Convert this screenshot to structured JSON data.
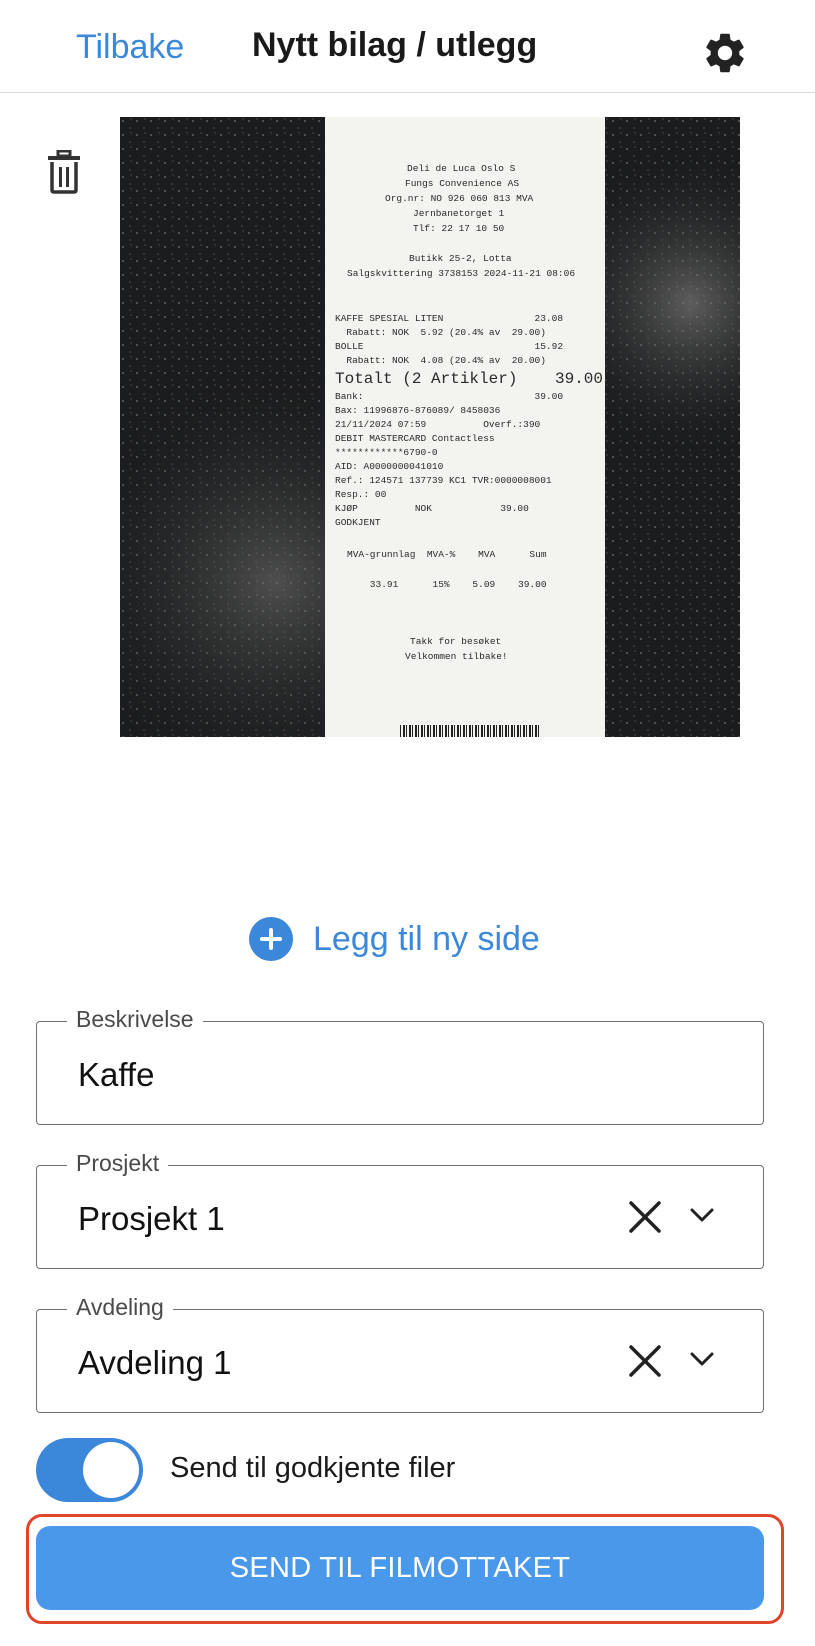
{
  "header": {
    "back_label": "Tilbake",
    "title": "Nytt bilag / utlegg",
    "settings_icon": "gear-icon"
  },
  "attachment": {
    "delete_icon": "trash-icon",
    "receipt_lines": {
      "l1": "Deli de Luca Oslo S",
      "l2": "Fungs Convenience AS",
      "l3": "Org.nr: NO 926 060 813 MVA",
      "l4": "Jernbanetorget 1",
      "l5": "Tlf: 22 17 10 50",
      "l6": "Butikk 25-2, Lotta",
      "l7": "Salgskvittering 3738153 2024-11-21 08:06",
      "l8": "KAFFE SPESIAL LITEN                23.08",
      "l9": "  Rabatt: NOK  5.92 (20.4% av  29.00)",
      "l10": "BOLLE                              15.92",
      "l11": "  Rabatt: NOK  4.08 (20.4% av  20.00)",
      "l12": "Totalt (2 Artikler)",
      "l12v": "39.00",
      "l13": "Bank:                              39.00",
      "l14": "Bax: 11996876-876089/ 8458036",
      "l15": "21/11/2024 07:59          Overf.:390",
      "l16": "DEBIT MASTERCARD Contactless",
      "l17": "************6790-0",
      "l18": "AID: A0000000041010",
      "l19": "Ref.: 124571 137739 KC1 TVR:0000008001",
      "l20": "Resp.: 00",
      "l21": "KJØP          NOK            39.00",
      "l22": "GODKJENT",
      "l23": "MVA-grunnlag  MVA-%    MVA      Sum",
      "l24": "    33.91      15%    5.09    39.00",
      "l25": "Takk for besøket",
      "l26": "Velkommen tilbake!"
    }
  },
  "add_page": {
    "label": "Legg til ny side",
    "icon": "plus-circle-icon"
  },
  "form": {
    "description": {
      "label": "Beskrivelse",
      "value": "Kaffe"
    },
    "project": {
      "label": "Prosjekt",
      "value": "Prosjekt 1"
    },
    "department": {
      "label": "Avdeling",
      "value": "Avdeling 1"
    },
    "approved_toggle": {
      "label": "Send til godkjente filer",
      "on": true
    }
  },
  "submit": {
    "label": "SEND TIL FILMOTTAKET"
  },
  "colors": {
    "accent": "#3b87d9",
    "button": "#4a98ea",
    "highlight": "#e0452b"
  }
}
